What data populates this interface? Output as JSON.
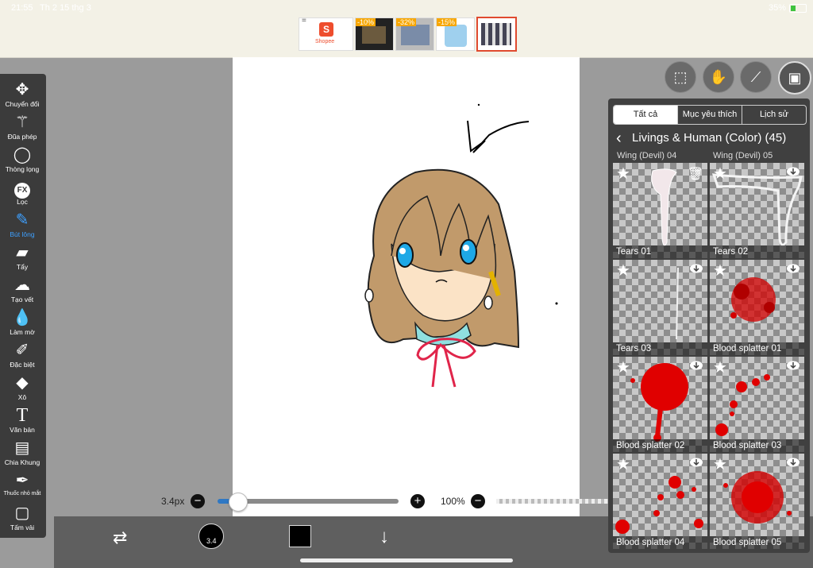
{
  "status": {
    "time": "21:55",
    "date": "Th 2 15 thg 3",
    "battery": "35%"
  },
  "shopee": {
    "logo_text": "Shopee",
    "badges": [
      "-10%",
      "-32%",
      "-15%"
    ]
  },
  "tools": [
    {
      "label": "Chuyển đổi",
      "icon": "move-icon"
    },
    {
      "label": "Đũa phép",
      "icon": "magic-wand-icon"
    },
    {
      "label": "Thòng lọng",
      "icon": "lasso-icon"
    },
    {
      "label": "Lọc",
      "icon": "fx-icon"
    },
    {
      "label": "Bút lông",
      "icon": "brush-icon",
      "active": true
    },
    {
      "label": "Tẩy",
      "icon": "eraser-icon"
    },
    {
      "label": "Tạo vết",
      "icon": "smudge-icon"
    },
    {
      "label": "Làm mờ",
      "icon": "blur-icon"
    },
    {
      "label": "Đặc biệt",
      "icon": "special-pen-icon"
    },
    {
      "label": "Xô",
      "icon": "bucket-icon"
    },
    {
      "label": "Văn bản",
      "icon": "text-icon"
    },
    {
      "label": "Chia Khung",
      "icon": "frame-divider-icon"
    },
    {
      "label": "Thuốc nhỏ mắt",
      "icon": "eyedropper-icon"
    },
    {
      "label": "Tấm vải",
      "icon": "canvas-icon"
    }
  ],
  "brush": {
    "size_label": "3.4px",
    "size_value": 3.4,
    "size_fraction": 0.11,
    "opacity_label": "100%",
    "color_badge": "3.4",
    "current_color": "#000000"
  },
  "panel": {
    "tabs": [
      "Tất cả",
      "Mục yêu thích",
      "Lịch sử"
    ],
    "category": "Livings & Human (Color) (45)",
    "partial_names": [
      "Wing (Devil) 04",
      "Wing (Devil) 05"
    ],
    "items": [
      "Tears 01",
      "Tears 02",
      "Tears 03",
      "Blood splatter 01",
      "Blood splatter 02",
      "Blood splatter 03",
      "Blood splatter 04",
      "Blood splatter 05"
    ]
  },
  "colors": {
    "accent": "#3ea0ff",
    "blood": "#d40000"
  }
}
